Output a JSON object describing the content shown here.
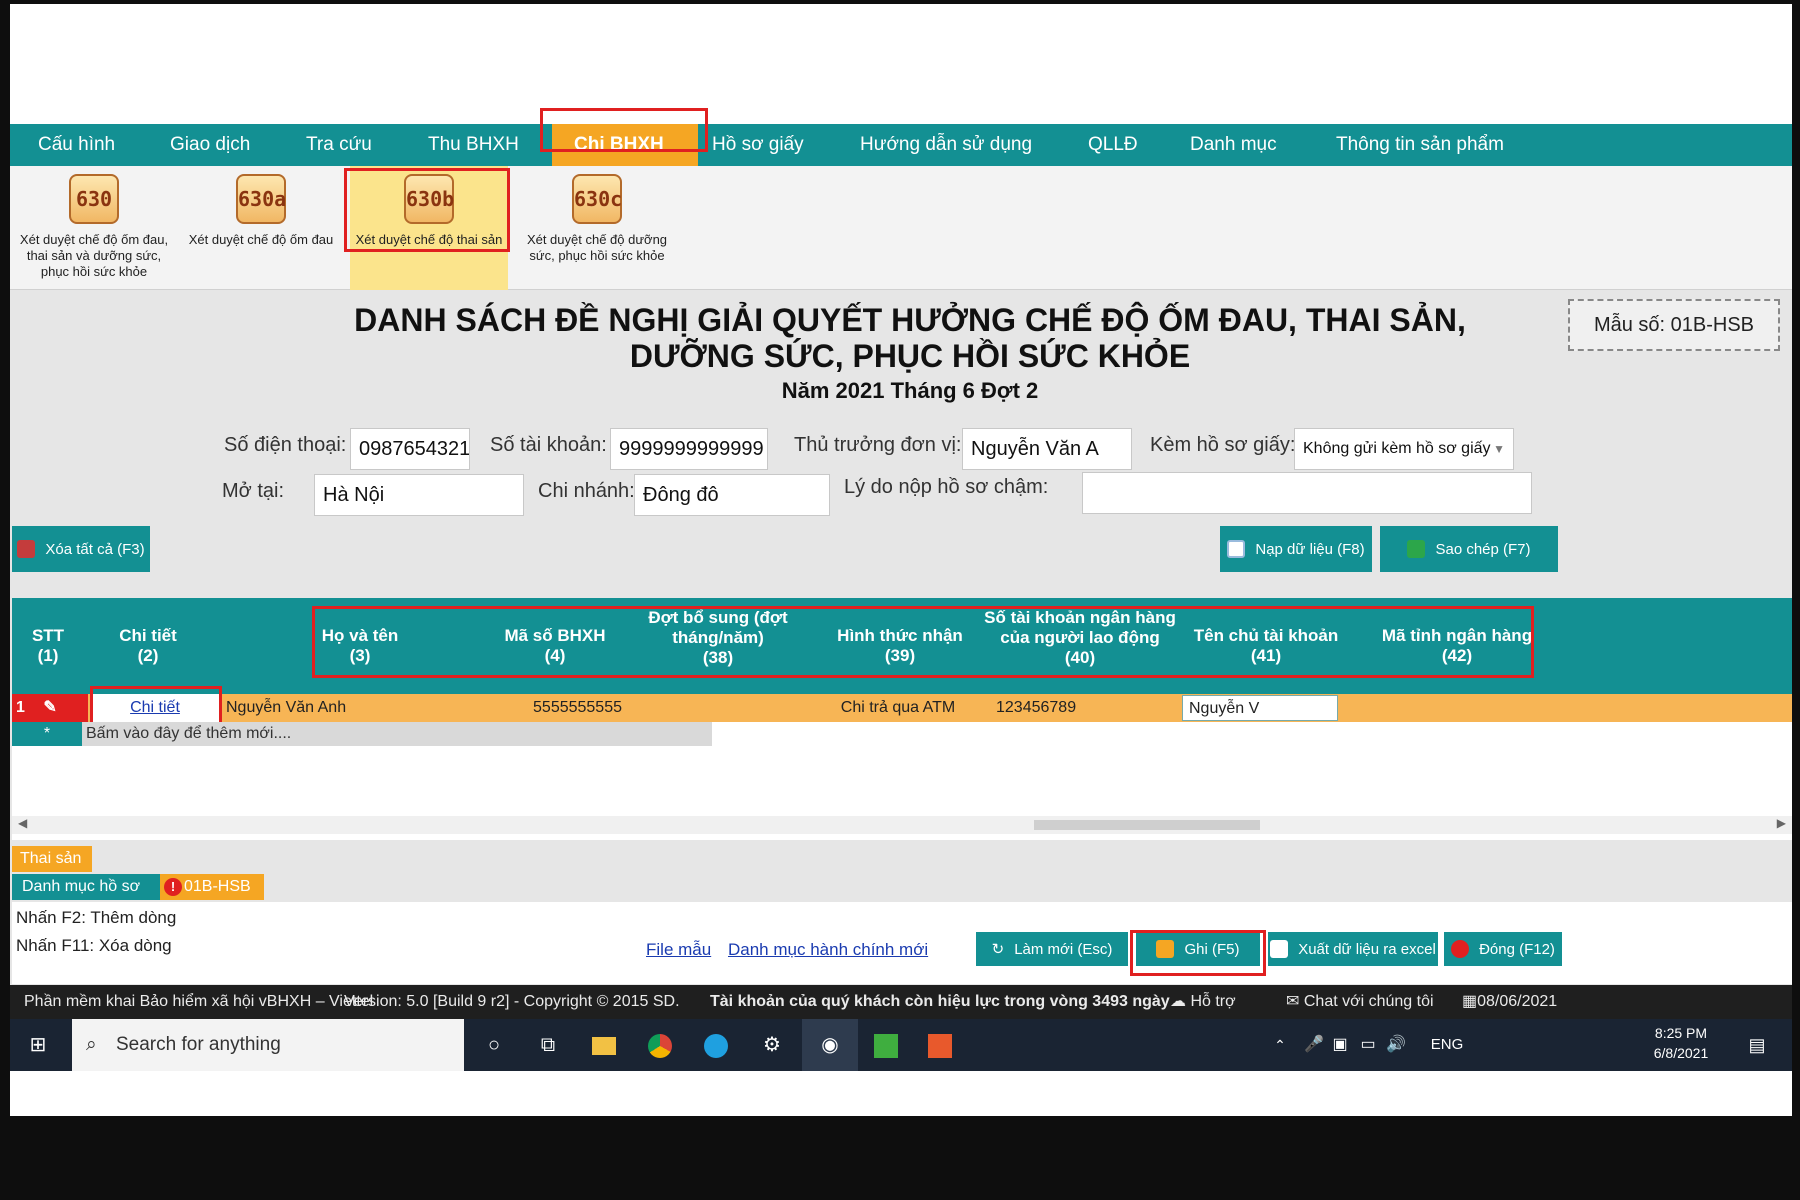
{
  "menu": {
    "items": [
      "Cấu hình",
      "Giao dịch",
      "Tra cứu",
      "Thu BHXH",
      "Chi BHXH",
      "Hồ sơ giấy",
      "Hướng dẫn sử dụng",
      "QLLĐ",
      "Danh mục",
      "Thông tin sản phẩm"
    ],
    "active": "Chi BHXH"
  },
  "ribbon": [
    {
      "code": "630",
      "label": "Xét duyệt chế độ ốm đau, thai sản và dưỡng sức, phục hồi sức khỏe"
    },
    {
      "code": "630a",
      "label": "Xét duyệt chế độ ốm đau"
    },
    {
      "code": "630b",
      "label": "Xét duyệt chế độ thai sản"
    },
    {
      "code": "630c",
      "label": "Xét duyệt chế độ dưỡng sức, phục hồi sức khỏe"
    }
  ],
  "title": {
    "line1": "DANH SÁCH ĐỀ NGHỊ GIẢI QUYẾT HƯỞNG CHẾ ĐỘ ỐM ĐAU, THAI SẢN,",
    "line2": "DƯỠNG SỨC, PHỤC HỒI SỨC KHỎE",
    "subtitle": "Năm 2021 Tháng 6 Đợt 2",
    "form_code": "Mẫu số: 01B-HSB"
  },
  "form": {
    "phone_label": "Số điện thoại:",
    "phone_value": "0987654321",
    "account_label": "Số tài khoản:",
    "account_value": "9999999999999",
    "head_label": "Thủ trưởng đơn vị:",
    "head_value": "Nguyễn Văn A",
    "paper_label": "Kèm hồ sơ giấy:",
    "paper_value": "Không gửi kèm hồ sơ giấy",
    "open_at_label": "Mở tại:",
    "open_at_value": "Hà Nội",
    "branch_label": "Chi nhánh:",
    "branch_value": "Đông đô",
    "late_reason_label": "Lý do nộp hồ sơ chậm:",
    "late_reason_value": ""
  },
  "actions": {
    "clear_all": "Xóa tất cả (F3)",
    "load_data": "Nạp dữ liệu (F8)",
    "copy": "Sao chép (F7)"
  },
  "grid": {
    "headers": [
      {
        "name": "STT",
        "num": "(1)"
      },
      {
        "name": "Chi tiết",
        "num": "(2)"
      },
      {
        "name": "Họ và tên",
        "num": "(3)"
      },
      {
        "name": "Mã số BHXH",
        "num": "(4)"
      },
      {
        "name": "Đợt bổ sung (đợt tháng/năm)",
        "num": "(38)"
      },
      {
        "name": "Hình thức nhận",
        "num": "(39)"
      },
      {
        "name": "Số tài khoản ngân hàng của người lao động",
        "num": "(40)"
      },
      {
        "name": "Tên chủ tài khoản",
        "num": "(41)"
      },
      {
        "name": "Mã tỉnh ngân hàng",
        "num": "(42)"
      }
    ],
    "row": {
      "stt": "1",
      "detail": "Chi tiết",
      "name": "Nguyễn Văn Anh",
      "bhxh": "5555555555",
      "dot": "",
      "receive": "Chi trả qua ATM",
      "bank_acc": "123456789",
      "holder_input": "Nguyễn V",
      "bank_province": ""
    },
    "new_row_marker": "*",
    "new_row_hint": "Bấm vào đây để thêm mới...."
  },
  "tabs": {
    "thai_san": "Thai sản",
    "danh_muc": "Danh mục hồ sơ",
    "code": "01B-HSB"
  },
  "hints": {
    "f2": "Nhấn F2: Thêm dòng",
    "f11": "Nhấn F11: Xóa dòng"
  },
  "links": {
    "sample": "File mẫu",
    "admin_list": "Danh mục hành chính mới"
  },
  "bottom_buttons": {
    "refresh": "Làm mới (Esc)",
    "save": "Ghi (F5)",
    "export": "Xuất dữ liệu ra excel",
    "close": "Đóng (F12)"
  },
  "status": {
    "app": "Phần mềm khai Bảo hiểm xã hội vBHXH – Viettel",
    "version": "Version: 5.0 [Build 9 r2] - Copyright © 2015 SD.",
    "license": "Tài khoản của quý khách còn hiệu lực trong vòng 3493 ngày",
    "support": "Hỗ trợ",
    "chat": "Chat với chúng tôi",
    "date": "08/06/2021"
  },
  "taskbar": {
    "search_placeholder": "Search for anything",
    "lang": "ENG",
    "time": "8:25 PM",
    "date": "6/8/2021"
  },
  "colors": {
    "teal": "#139093",
    "orange": "#f5a623",
    "highlight_red": "#e02020",
    "row_orange": "#f7b555"
  }
}
